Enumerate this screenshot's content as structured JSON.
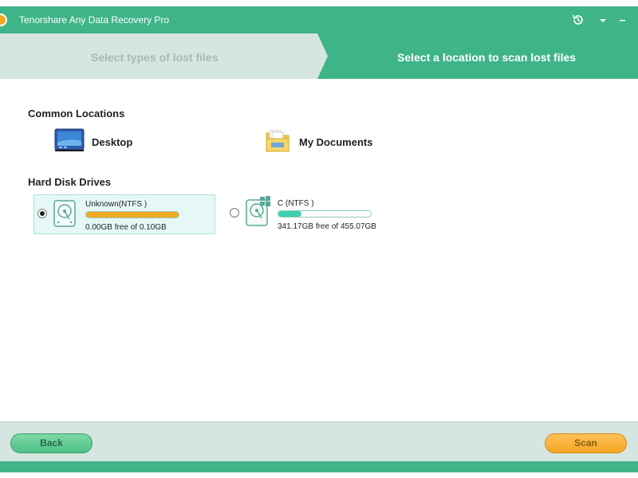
{
  "window": {
    "title": "Tenorshare Any Data Recovery Pro",
    "accent_color": "#3fb489",
    "icons": [
      "history-icon",
      "dropdown-arrow-icon",
      "minimize-icon"
    ]
  },
  "steps": [
    {
      "label": "Select types of lost files",
      "active": false
    },
    {
      "label": "Select a location to scan lost files",
      "active": true
    }
  ],
  "common_locations": {
    "title": "Common Locations",
    "items": [
      {
        "label": "Desktop",
        "icon": "desktop-icon"
      },
      {
        "label": "My Documents",
        "icon": "folder-icon"
      }
    ]
  },
  "hard_disk_drives": {
    "title": "Hard Disk Drives",
    "drives": [
      {
        "name": "Unknown(NTFS )",
        "free_text": "0.00GB free of 0.10GB",
        "used_fraction": 1.0,
        "selected": true,
        "bar_color": "#f5a623"
      },
      {
        "name": "C  (NTFS )",
        "free_text": "341.17GB free of 455.07GB",
        "used_fraction": 0.25,
        "selected": false,
        "bar_color": "#3fcfb0"
      }
    ]
  },
  "footer": {
    "back_label": "Back",
    "scan_label": "Scan"
  }
}
